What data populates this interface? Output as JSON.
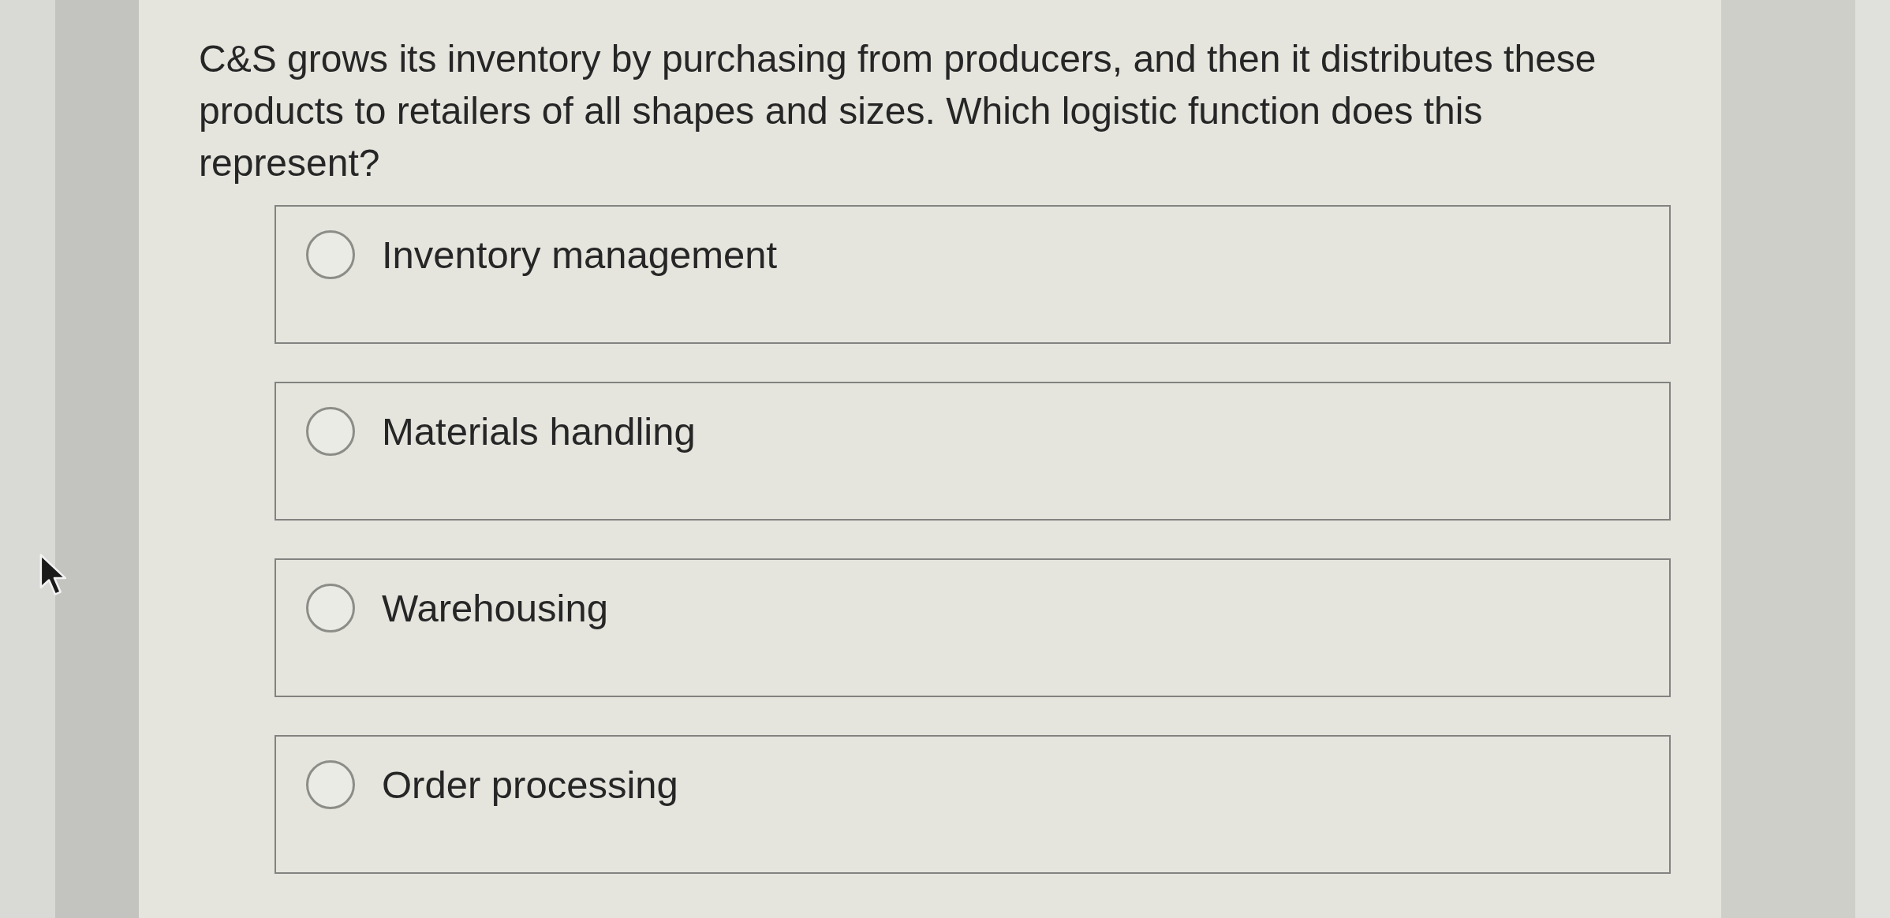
{
  "question": {
    "text": "C&S grows its inventory by purchasing from producers, and then it distributes these products to retailers of all shapes and sizes. Which logistic function does this represent?"
  },
  "options": [
    {
      "label": "Inventory management",
      "selected": false
    },
    {
      "label": "Materials handling",
      "selected": false
    },
    {
      "label": "Warehousing",
      "selected": false
    },
    {
      "label": "Order processing",
      "selected": false
    }
  ]
}
